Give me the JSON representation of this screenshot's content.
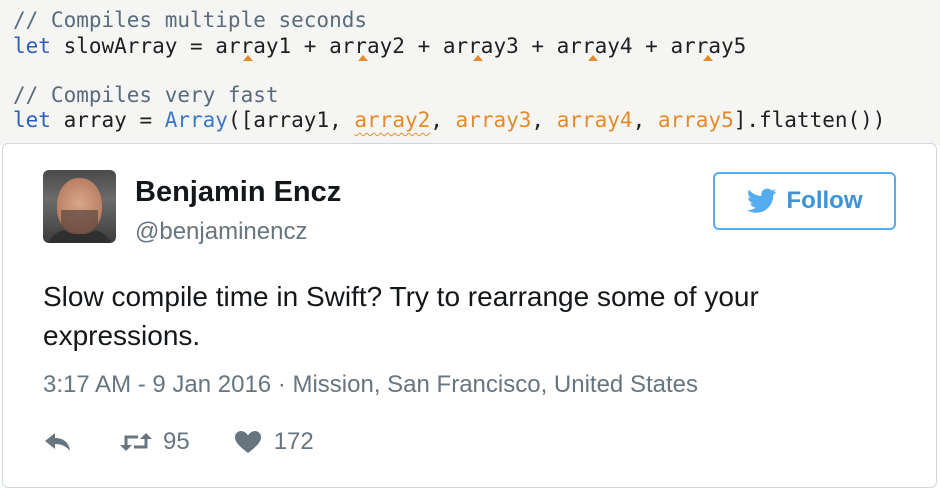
{
  "code": {
    "comment1": "// Compiles multiple seconds",
    "line1": {
      "kw": "let",
      "rest": " slowArray = array1 + array2 + array3 + array4 + array5"
    },
    "comment2": "// Compiles very fast",
    "line2": {
      "kw": "let",
      "mid": " array = ",
      "type": "Array",
      "open": "([array1, ",
      "a2": "array2",
      "s1": ", ",
      "a3": "array3",
      "s2": ", ",
      "a4": "array4",
      "s3": ", ",
      "a5": "array5",
      "close": "].flatten())"
    }
  },
  "tweet": {
    "name": "Benjamin Encz",
    "handle": "@benjaminencz",
    "follow_label": "Follow",
    "text": "Slow compile time in Swift? Try to rearrange some of your expressions.",
    "meta": "3:17 AM - 9 Jan 2016 · Mission, San Francisco, United States",
    "retweets": "95",
    "likes": "172"
  },
  "colors": {
    "twitter_blue": "#55acee",
    "code_keyword": "#2b60b6",
    "code_warning": "#e58a2a",
    "meta_gray": "#66757f"
  },
  "icons": [
    "twitter-bird-icon",
    "reply-icon",
    "retweet-icon",
    "heart-icon"
  ]
}
